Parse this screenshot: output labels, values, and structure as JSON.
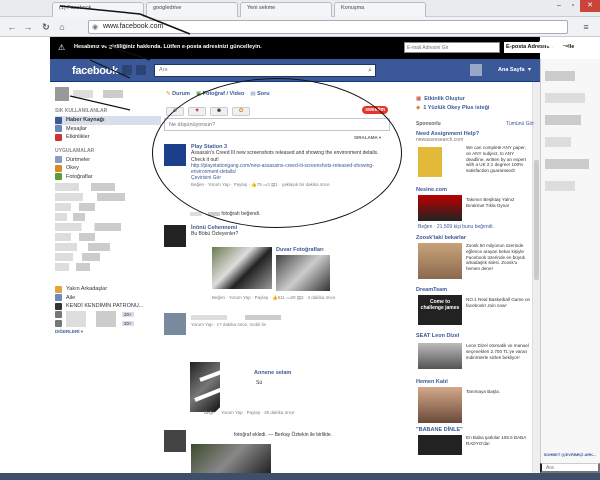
{
  "browser": {
    "tabs": [
      {
        "title": "(1) Facebook"
      },
      {
        "title": "googledrive"
      },
      {
        "title": "Yeni sekme"
      },
      {
        "title": "Konuşma"
      }
    ],
    "url": "www.facebook.com"
  },
  "notice": {
    "text": "Hesabınız ve gizliliğiniz hakkında. Lütfen e-posta adresinizi güncelleyin.",
    "email_placeholder": "E-mail Adresini Gir",
    "submit_label": "E-posta Adresini Güncelle"
  },
  "fbbar": {
    "logo": "facebook",
    "search_placeholder": "Ara",
    "home_link": "Ana Sayfa"
  },
  "left": {
    "favorites_header": "SIK KULLANILANLAR",
    "favorites": [
      "Haber Kaynağı",
      "Mesajlar",
      "Etkinlikler"
    ],
    "apps_header": "UYGULAMALAR",
    "apps": [
      "Dürtmeler",
      "Okey",
      "Fotoğraflar"
    ],
    "friends": [
      "Yakın Arkadaşlar",
      "Aile",
      "KENDİ KENDİMİN PATRONU..."
    ],
    "count_badge": "20+",
    "more": "DİĞERLERİ ▾"
  },
  "composer": {
    "tabs": [
      "Durum",
      "Fotoğraf / Video",
      "Soru"
    ],
    "status_placeholder": "Ne düşünüyorsun?",
    "sweet_label": "sweetim",
    "sort_label": "SIRALAMA ▾"
  },
  "posts": [
    {
      "author": "Play Station 3",
      "text": "Assassin's Creed III new screenshots released and showing the environment details. Check it out!",
      "link": "http://playstationgang.com/new-assassins-creed-iii-screenshots-released-showing-environment-details/",
      "extra": "Çevirisini Gör",
      "actions": "Beğen · Yorum Yap · Paylaş · ",
      "likes": "75",
      "comments": "3",
      "shares": "1",
      "time": "yaklaşık bir dakika önce"
    },
    {
      "author": "İnönü Cehennemi",
      "text": "Bu Böbü Özleyenler?",
      "album": "Duvar Fotoğrafları",
      "actions": "Beğen · Yorum Yap · Paylaş · ",
      "likes": "511",
      "comments": "29",
      "shares": "2",
      "time": "3 dakika önce"
    }
  ],
  "feed_misc": {
    "liked_photo": "fotoğrafı beğendi.",
    "p3_meta": "Yorum Yap · 17 dakika önce, mobil ile",
    "p4_author": "Annene selam",
    "p4_sub": "Sü",
    "p4_meta": "Beğen · Yorum Yap · Paylaş · 35 dakika önce",
    "p5_text": "fotoğraf ekledi. — Berkay Öztekin ile birlikte."
  },
  "right": {
    "events": [
      "Etkinlik Oluştur",
      "1 Yüzlük Okey Plus isteği"
    ],
    "sponsored": "Sponsorlu",
    "create_ad": "Tümünü Gör",
    "ads": [
      {
        "title": "Need Assignment Help?",
        "sub": "newassresearch.com",
        "text": "We can complete ANY paper, on ANY subject, to ANY deadline, written by an expert with a UK 2:1 degree! 100% satisfaction guaranteed!"
      },
      {
        "title": "Nesine.com",
        "sub": "",
        "text": "Takımın Beşiktaş Yalnız Bırakma! Tıkla Oyna!",
        "likes": "Beğen · 21.509 kişi bunu beğendi."
      },
      {
        "title": "Zoosk'taki bekarlar",
        "sub": "",
        "text": "Zoosk 50 milyonun üzerinde eğlence arayan bekar kişiyle Facebook üzerinde en büyük arkadaşlık sitesi. Zoosk'u hemen dene!"
      },
      {
        "title": "DreamTeam",
        "sub": "",
        "text": "NO.1 Real Basketball Game on facebook! Join now!",
        "img_text": "Come to challenge james"
      },
      {
        "title": "SEAT Leon Dizel",
        "sub": "",
        "text": "Leon Dizel otomatik ve manuel seçenekleri 2.700 TL'ye varan indirimlerle sizleri bekliyor!"
      },
      {
        "title": "Hemen Katıl",
        "sub": "",
        "text": "Tanımaya Başla."
      },
      {
        "title": "\"BABANE DİNLE\"",
        "sub": "",
        "text": "En Baba şarkılar 105.6 BABA RADYO'da!"
      }
    ]
  },
  "chat": {
    "online_bar": "SOHBET (ÇEVRİMİÇİ ARK...",
    "search_placeholder": "Ara"
  },
  "colors": {
    "facebook_blue": "#3b5998",
    "link": "#3b5998",
    "notice_bg": "#000000"
  }
}
